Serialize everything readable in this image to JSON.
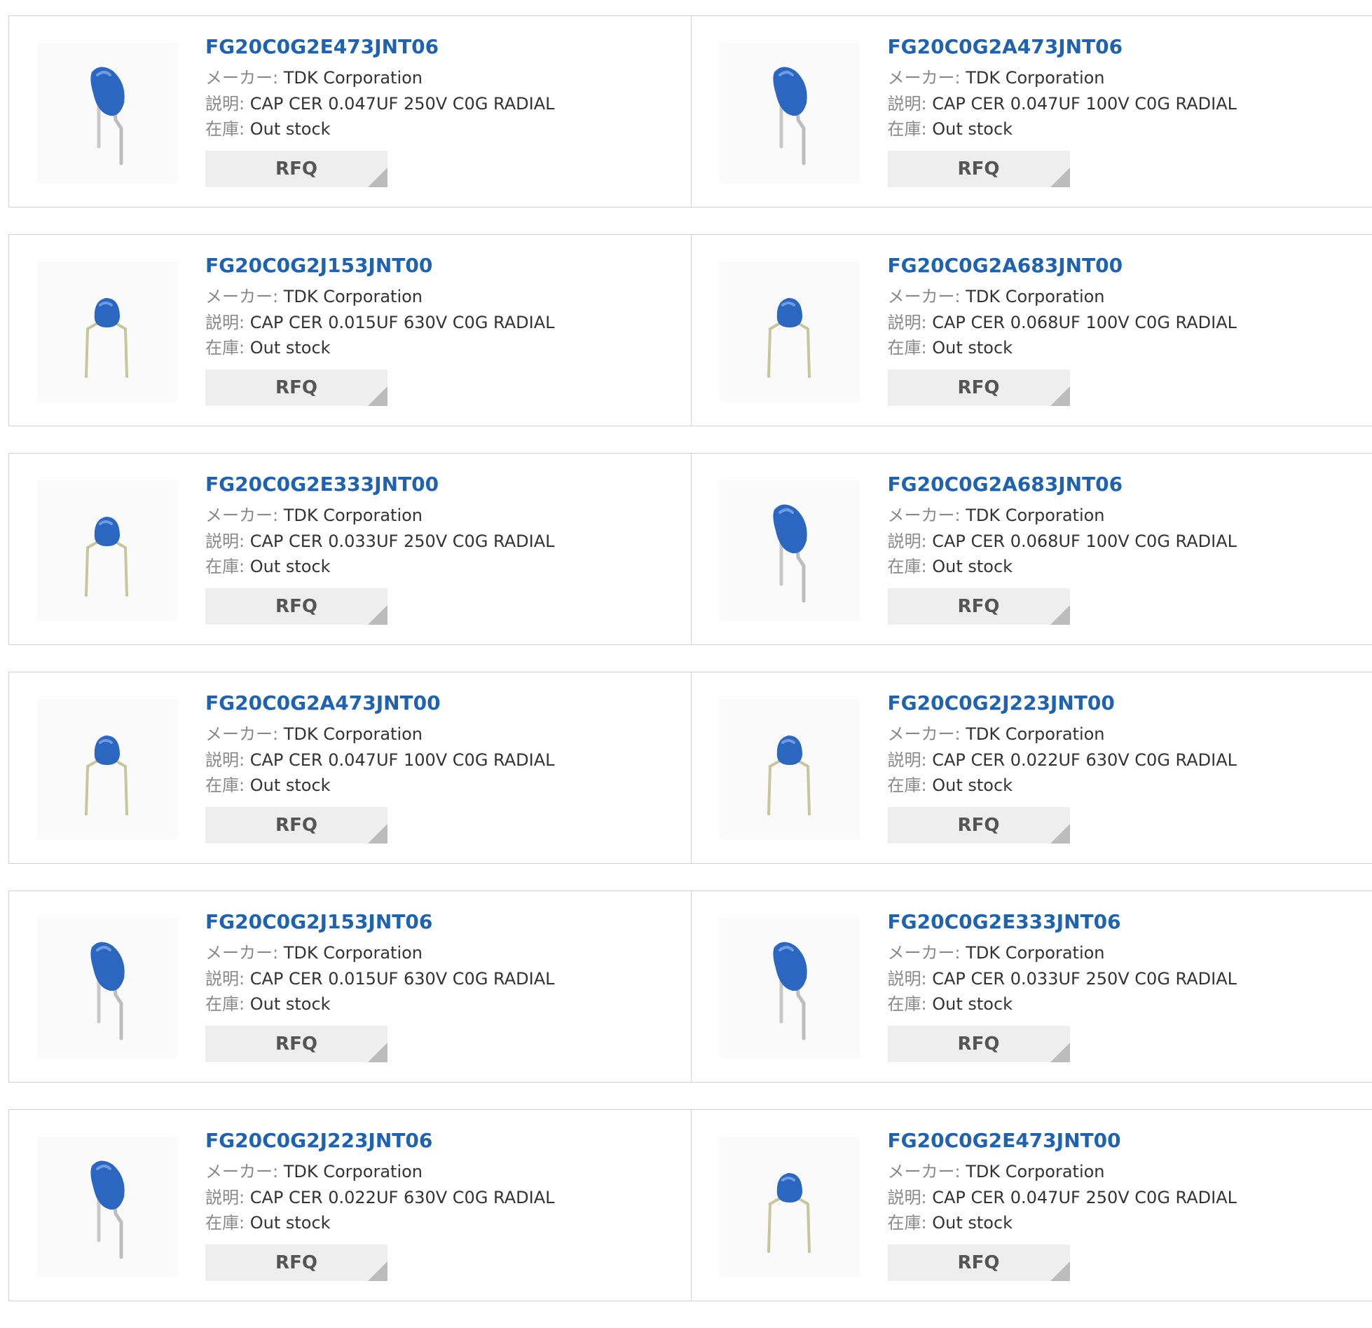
{
  "labels": {
    "maker": "メーカー:",
    "description": "説明:",
    "stock": "在庫:",
    "rfq": "RFQ"
  },
  "colors": {
    "part_link": "#1f63b0",
    "capacitor_body": "#2b67c0",
    "rfq_background": "#eeeeee",
    "border": "#d0d0d0"
  },
  "products": [
    {
      "part_number": "FG20C0G2E473JNT06",
      "maker": "TDK Corporation",
      "description": "CAP CER 0.047UF 250V C0G RADIAL",
      "stock": "Out stock",
      "icon": "capacitor-straight-leads-icon"
    },
    {
      "part_number": "FG20C0G2A473JNT06",
      "maker": "TDK Corporation",
      "description": "CAP CER 0.047UF 100V C0G RADIAL",
      "stock": "Out stock",
      "icon": "capacitor-straight-leads-icon"
    },
    {
      "part_number": "FG20C0G2J153JNT00",
      "maker": "TDK Corporation",
      "description": "CAP CER 0.015UF 630V C0G RADIAL",
      "stock": "Out stock",
      "icon": "capacitor-bent-leads-icon"
    },
    {
      "part_number": "FG20C0G2A683JNT00",
      "maker": "TDK Corporation",
      "description": "CAP CER 0.068UF 100V C0G RADIAL",
      "stock": "Out stock",
      "icon": "capacitor-bent-leads-icon"
    },
    {
      "part_number": "FG20C0G2E333JNT00",
      "maker": "TDK Corporation",
      "description": "CAP CER 0.033UF 250V C0G RADIAL",
      "stock": "Out stock",
      "icon": "capacitor-bent-leads-icon"
    },
    {
      "part_number": "FG20C0G2A683JNT06",
      "maker": "TDK Corporation",
      "description": "CAP CER 0.068UF 100V C0G RADIAL",
      "stock": "Out stock",
      "icon": "capacitor-straight-leads-icon"
    },
    {
      "part_number": "FG20C0G2A473JNT00",
      "maker": "TDK Corporation",
      "description": "CAP CER 0.047UF 100V C0G RADIAL",
      "stock": "Out stock",
      "icon": "capacitor-bent-leads-icon"
    },
    {
      "part_number": "FG20C0G2J223JNT00",
      "maker": "TDK Corporation",
      "description": "CAP CER 0.022UF 630V C0G RADIAL",
      "stock": "Out stock",
      "icon": "capacitor-bent-leads-icon"
    },
    {
      "part_number": "FG20C0G2J153JNT06",
      "maker": "TDK Corporation",
      "description": "CAP CER 0.015UF 630V C0G RADIAL",
      "stock": "Out stock",
      "icon": "capacitor-straight-leads-icon"
    },
    {
      "part_number": "FG20C0G2E333JNT06",
      "maker": "TDK Corporation",
      "description": "CAP CER 0.033UF 250V C0G RADIAL",
      "stock": "Out stock",
      "icon": "capacitor-straight-leads-icon"
    },
    {
      "part_number": "FG20C0G2J223JNT06",
      "maker": "TDK Corporation",
      "description": "CAP CER 0.022UF 630V C0G RADIAL",
      "stock": "Out stock",
      "icon": "capacitor-straight-leads-icon"
    },
    {
      "part_number": "FG20C0G2E473JNT00",
      "maker": "TDK Corporation",
      "description": "CAP CER 0.047UF 250V C0G RADIAL",
      "stock": "Out stock",
      "icon": "capacitor-bent-leads-icon"
    }
  ]
}
